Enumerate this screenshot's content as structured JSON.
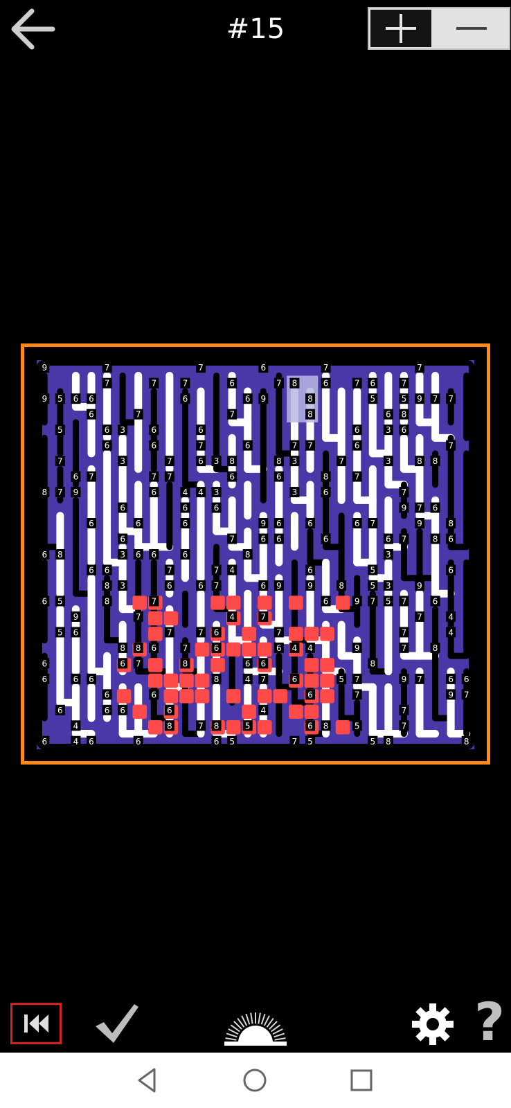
{
  "header": {
    "title": "#15",
    "back_icon": "arrow-left-icon",
    "zoom_in_icon": "plus-icon",
    "zoom_out_icon": "minus-icon"
  },
  "puzzle": {
    "grid_cols": 27,
    "grid_rows": 24,
    "highlight_cells": [
      [
        16,
        1
      ],
      [
        17,
        1
      ],
      [
        16,
        2
      ],
      [
        17,
        2
      ],
      [
        16,
        3
      ],
      [
        17,
        3
      ]
    ],
    "clues": [
      [
        0,
        0,
        "9"
      ],
      [
        4,
        0,
        "7"
      ],
      [
        10,
        0,
        "7"
      ],
      [
        14,
        0,
        "6"
      ],
      [
        18,
        0,
        "7"
      ],
      [
        24,
        0,
        "7"
      ],
      [
        4,
        1,
        "7"
      ],
      [
        7,
        1,
        "7"
      ],
      [
        9,
        1,
        "7"
      ],
      [
        12,
        1,
        "6"
      ],
      [
        15,
        1,
        "7"
      ],
      [
        16,
        1,
        "8"
      ],
      [
        18,
        1,
        "6"
      ],
      [
        20,
        1,
        "7"
      ],
      [
        21,
        1,
        "6"
      ],
      [
        23,
        1,
        "7"
      ],
      [
        0,
        2,
        "9"
      ],
      [
        1,
        2,
        "5"
      ],
      [
        2,
        2,
        "6"
      ],
      [
        3,
        2,
        "6"
      ],
      [
        9,
        2,
        "6"
      ],
      [
        13,
        2,
        "6"
      ],
      [
        14,
        2,
        "9"
      ],
      [
        17,
        2,
        "8"
      ],
      [
        21,
        2,
        "5"
      ],
      [
        23,
        2,
        "5"
      ],
      [
        24,
        2,
        "9"
      ],
      [
        25,
        2,
        "7"
      ],
      [
        26,
        2,
        "7"
      ],
      [
        3,
        3,
        "6"
      ],
      [
        6,
        3,
        "7"
      ],
      [
        12,
        3,
        "7"
      ],
      [
        17,
        3,
        "8"
      ],
      [
        22,
        3,
        "6"
      ],
      [
        23,
        3,
        "8"
      ],
      [
        1,
        4,
        "5"
      ],
      [
        4,
        4,
        "6"
      ],
      [
        5,
        4,
        "3"
      ],
      [
        7,
        4,
        "6"
      ],
      [
        10,
        4,
        "6"
      ],
      [
        20,
        4,
        "6"
      ],
      [
        22,
        4,
        "3"
      ],
      [
        23,
        4,
        "6"
      ],
      [
        4,
        5,
        "6"
      ],
      [
        7,
        5,
        "6"
      ],
      [
        10,
        5,
        "7"
      ],
      [
        13,
        5,
        "6"
      ],
      [
        16,
        5,
        "7"
      ],
      [
        17,
        5,
        "7"
      ],
      [
        20,
        5,
        "6"
      ],
      [
        26,
        5,
        "7"
      ],
      [
        1,
        6,
        "7"
      ],
      [
        5,
        6,
        "3"
      ],
      [
        8,
        6,
        "7"
      ],
      [
        10,
        6,
        "6"
      ],
      [
        11,
        6,
        "3"
      ],
      [
        12,
        6,
        "8"
      ],
      [
        15,
        6,
        "8"
      ],
      [
        16,
        6,
        "3"
      ],
      [
        19,
        6,
        "7"
      ],
      [
        22,
        6,
        "3"
      ],
      [
        24,
        6,
        "8"
      ],
      [
        25,
        6,
        "8"
      ],
      [
        2,
        7,
        "6"
      ],
      [
        3,
        7,
        "7"
      ],
      [
        7,
        7,
        "7"
      ],
      [
        8,
        7,
        "7"
      ],
      [
        12,
        7,
        "6"
      ],
      [
        15,
        7,
        "6"
      ],
      [
        18,
        7,
        "8"
      ],
      [
        20,
        7,
        "7"
      ],
      [
        0,
        8,
        "8"
      ],
      [
        1,
        8,
        "7"
      ],
      [
        2,
        8,
        "9"
      ],
      [
        7,
        8,
        "6"
      ],
      [
        9,
        8,
        "4"
      ],
      [
        10,
        8,
        "4"
      ],
      [
        11,
        8,
        "3"
      ],
      [
        16,
        8,
        "3"
      ],
      [
        18,
        8,
        "6"
      ],
      [
        23,
        8,
        "7"
      ],
      [
        5,
        9,
        "6"
      ],
      [
        9,
        9,
        "6"
      ],
      [
        11,
        9,
        "6"
      ],
      [
        23,
        9,
        "9"
      ],
      [
        24,
        9,
        "7"
      ],
      [
        25,
        9,
        "6"
      ],
      [
        3,
        10,
        "6"
      ],
      [
        6,
        10,
        "6"
      ],
      [
        9,
        10,
        "6"
      ],
      [
        14,
        10,
        "9"
      ],
      [
        15,
        10,
        "6"
      ],
      [
        17,
        10,
        "6"
      ],
      [
        20,
        10,
        "6"
      ],
      [
        21,
        10,
        "7"
      ],
      [
        24,
        10,
        "9"
      ],
      [
        26,
        10,
        "8"
      ],
      [
        5,
        11,
        "6"
      ],
      [
        12,
        11,
        "7"
      ],
      [
        14,
        11,
        "6"
      ],
      [
        15,
        11,
        "6"
      ],
      [
        18,
        11,
        "6"
      ],
      [
        22,
        11,
        "6"
      ],
      [
        23,
        11,
        "7"
      ],
      [
        25,
        11,
        "8"
      ],
      [
        26,
        11,
        "6"
      ],
      [
        0,
        12,
        "6"
      ],
      [
        1,
        12,
        "8"
      ],
      [
        5,
        12,
        "3"
      ],
      [
        6,
        12,
        "6"
      ],
      [
        7,
        12,
        "6"
      ],
      [
        9,
        12,
        "6"
      ],
      [
        13,
        12,
        "8"
      ],
      [
        22,
        12,
        "3"
      ],
      [
        3,
        13,
        "6"
      ],
      [
        4,
        13,
        "6"
      ],
      [
        8,
        13,
        "7"
      ],
      [
        11,
        13,
        "7"
      ],
      [
        12,
        13,
        "4"
      ],
      [
        17,
        13,
        "6"
      ],
      [
        21,
        13,
        "5"
      ],
      [
        26,
        13,
        "6"
      ],
      [
        4,
        14,
        "8"
      ],
      [
        5,
        14,
        "3"
      ],
      [
        8,
        14,
        "6"
      ],
      [
        10,
        14,
        "6"
      ],
      [
        11,
        14,
        "7"
      ],
      [
        14,
        14,
        "6"
      ],
      [
        15,
        14,
        "9"
      ],
      [
        17,
        14,
        "9"
      ],
      [
        19,
        14,
        "8"
      ],
      [
        21,
        14,
        "5"
      ],
      [
        22,
        14,
        "3"
      ],
      [
        24,
        14,
        "9"
      ],
      [
        0,
        15,
        "6"
      ],
      [
        1,
        15,
        "5"
      ],
      [
        4,
        15,
        "8"
      ],
      [
        7,
        15,
        "7"
      ],
      [
        18,
        15,
        "6"
      ],
      [
        20,
        15,
        "9"
      ],
      [
        21,
        15,
        "7"
      ],
      [
        22,
        15,
        "5"
      ],
      [
        23,
        15,
        "7"
      ],
      [
        25,
        15,
        "6"
      ],
      [
        2,
        16,
        "9"
      ],
      [
        6,
        16,
        "7"
      ],
      [
        12,
        16,
        "4"
      ],
      [
        14,
        16,
        "7"
      ],
      [
        24,
        16,
        "7"
      ],
      [
        26,
        16,
        "4"
      ],
      [
        1,
        17,
        "5"
      ],
      [
        2,
        17,
        "6"
      ],
      [
        8,
        17,
        "7"
      ],
      [
        10,
        17,
        "7"
      ],
      [
        11,
        17,
        "6"
      ],
      [
        15,
        17,
        "7"
      ],
      [
        23,
        17,
        "7"
      ],
      [
        26,
        17,
        "4"
      ],
      [
        5,
        18,
        "8"
      ],
      [
        6,
        18,
        "8"
      ],
      [
        7,
        18,
        "6"
      ],
      [
        9,
        18,
        "7"
      ],
      [
        11,
        18,
        "6"
      ],
      [
        15,
        18,
        "6"
      ],
      [
        16,
        18,
        "4"
      ],
      [
        17,
        18,
        "4"
      ],
      [
        20,
        18,
        "9"
      ],
      [
        23,
        18,
        "7"
      ],
      [
        25,
        18,
        "8"
      ],
      [
        0,
        19,
        "6"
      ],
      [
        5,
        19,
        "6"
      ],
      [
        6,
        19,
        "7"
      ],
      [
        9,
        19,
        "8"
      ],
      [
        13,
        19,
        "6"
      ],
      [
        14,
        19,
        "6"
      ],
      [
        21,
        19,
        "8"
      ],
      [
        0,
        20,
        "6"
      ],
      [
        2,
        20,
        "6"
      ],
      [
        3,
        20,
        "6"
      ],
      [
        11,
        20,
        "8"
      ],
      [
        13,
        20,
        "4"
      ],
      [
        14,
        20,
        "7"
      ],
      [
        16,
        20,
        "6"
      ],
      [
        19,
        20,
        "5"
      ],
      [
        20,
        20,
        "7"
      ],
      [
        23,
        20,
        "9"
      ],
      [
        24,
        20,
        "7"
      ],
      [
        26,
        20,
        "6"
      ],
      [
        27,
        20,
        "6"
      ],
      [
        4,
        21,
        "6"
      ],
      [
        7,
        21,
        "6"
      ],
      [
        17,
        21,
        "6"
      ],
      [
        20,
        21,
        "7"
      ],
      [
        26,
        21,
        "9"
      ],
      [
        27,
        21,
        "7"
      ],
      [
        1,
        22,
        "6"
      ],
      [
        4,
        22,
        "6"
      ],
      [
        5,
        22,
        "6"
      ],
      [
        8,
        22,
        "6"
      ],
      [
        14,
        22,
        "4"
      ],
      [
        23,
        22,
        "7"
      ],
      [
        2,
        23,
        "4"
      ],
      [
        8,
        23,
        "8"
      ],
      [
        10,
        23,
        "7"
      ],
      [
        11,
        23,
        "8"
      ],
      [
        13,
        23,
        "5"
      ],
      [
        17,
        23,
        "6"
      ],
      [
        18,
        23,
        "8"
      ],
      [
        20,
        23,
        "5"
      ],
      [
        23,
        23,
        "7"
      ],
      [
        0,
        24,
        "6"
      ],
      [
        2,
        24,
        "4"
      ],
      [
        3,
        24,
        "6"
      ],
      [
        6,
        24,
        "6"
      ],
      [
        11,
        24,
        "6"
      ],
      [
        12,
        24,
        "5"
      ],
      [
        16,
        24,
        "7"
      ],
      [
        17,
        24,
        "5"
      ],
      [
        21,
        24,
        "5"
      ],
      [
        22,
        24,
        "8"
      ],
      [
        27,
        24,
        "8"
      ]
    ],
    "colors": {
      "board_bg": "#4a38a8",
      "wall": "#000000",
      "path": "#ffffff",
      "red_path": "#ff4a4a",
      "highlight": "#b9b9e6",
      "frame": "#ff8a1a",
      "text": "#ffffff"
    }
  },
  "toolbar": {
    "rewind_icon": "rewind-icon",
    "check_icon": "checkmark-icon",
    "sun_icon": "sunrise-icon",
    "gear_icon": "gear-icon",
    "help_label": "?"
  },
  "navbar": {
    "back_icon": "nav-back-triangle-icon",
    "home_icon": "nav-home-circle-icon",
    "recent_icon": "nav-recent-square-icon"
  }
}
